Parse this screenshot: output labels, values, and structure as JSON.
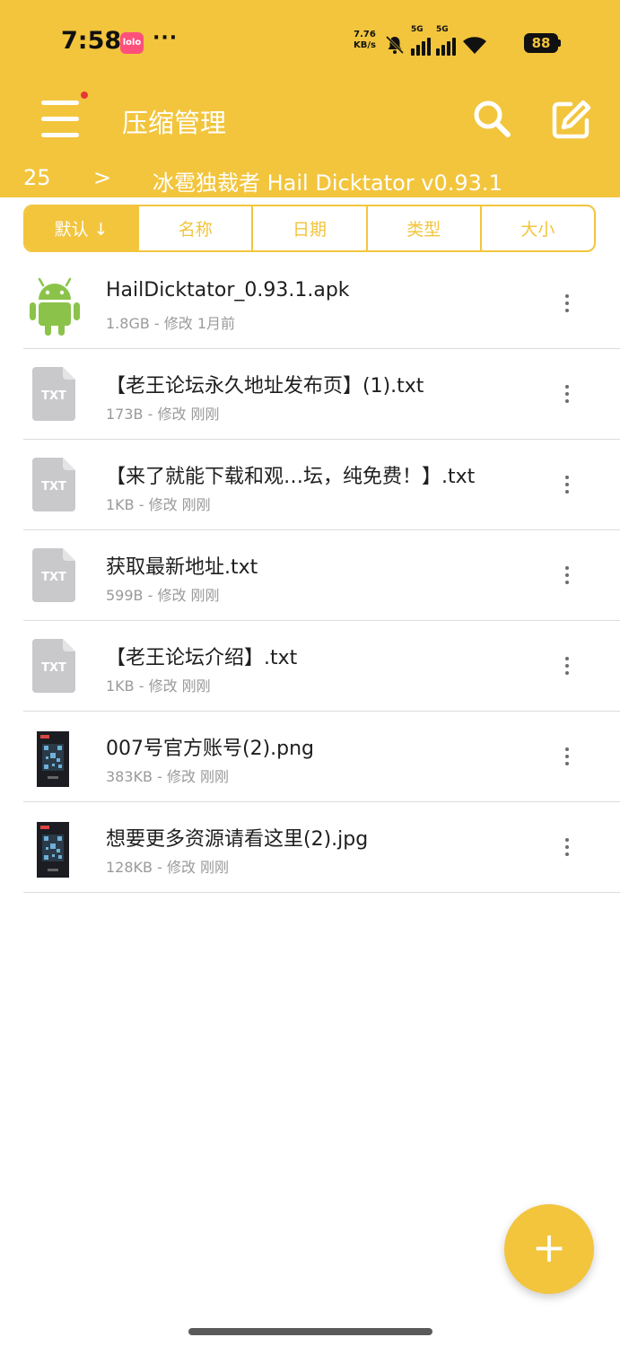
{
  "status_bar": {
    "time": "7:58",
    "app_icon_text": "lolo",
    "dots": "···",
    "speed_value": "7.76",
    "speed_unit": "KB/s",
    "net1": "5G",
    "net2": "5G",
    "battery": "88"
  },
  "app_bar": {
    "title": "压缩管理",
    "crumb_number": "25",
    "crumb_separator": ">",
    "crumb_path": "冰雹独裁者 Hail Dicktator v0.93.1"
  },
  "sort_tabs": [
    {
      "label": "默认 ↓",
      "active": true
    },
    {
      "label": "名称",
      "active": false
    },
    {
      "label": "日期",
      "active": false
    },
    {
      "label": "类型",
      "active": false
    },
    {
      "label": "大小",
      "active": false
    }
  ],
  "files": [
    {
      "name": "HailDicktator_0.93.1.apk",
      "meta": "1.8GB - 修改 1月前",
      "type": "apk"
    },
    {
      "name": "【老王论坛永久地址发布页】(1).txt",
      "meta": "173B - 修改 刚刚",
      "type": "txt"
    },
    {
      "name": "【来了就能下载和观…坛，纯免费！】.txt",
      "meta": "1KB - 修改 刚刚",
      "type": "txt"
    },
    {
      "name": "获取最新地址.txt",
      "meta": "599B - 修改 刚刚",
      "type": "txt"
    },
    {
      "name": "【老王论坛介绍】.txt",
      "meta": "1KB - 修改 刚刚",
      "type": "txt"
    },
    {
      "name": "007号官方账号(2).png",
      "meta": "383KB - 修改 刚刚",
      "type": "image"
    },
    {
      "name": "想要更多资源请看这里(2).jpg",
      "meta": "128KB - 修改 刚刚",
      "type": "image"
    }
  ],
  "txt_badge": "TXT",
  "fab_symbol": "+",
  "colors": {
    "accent": "#f2c53d",
    "android_green": "#8bc34a",
    "txt_icon_gray": "#c9c9cc",
    "notification_dot": "#e53935"
  },
  "icons": {
    "menu": "hamburger-menu-icon",
    "search": "search-icon",
    "edit": "edit-icon",
    "apk": "android-icon",
    "txt": "txt-file-icon",
    "image": "image-thumbnail",
    "more": "more-vertical-icon",
    "fab": "plus-icon"
  }
}
